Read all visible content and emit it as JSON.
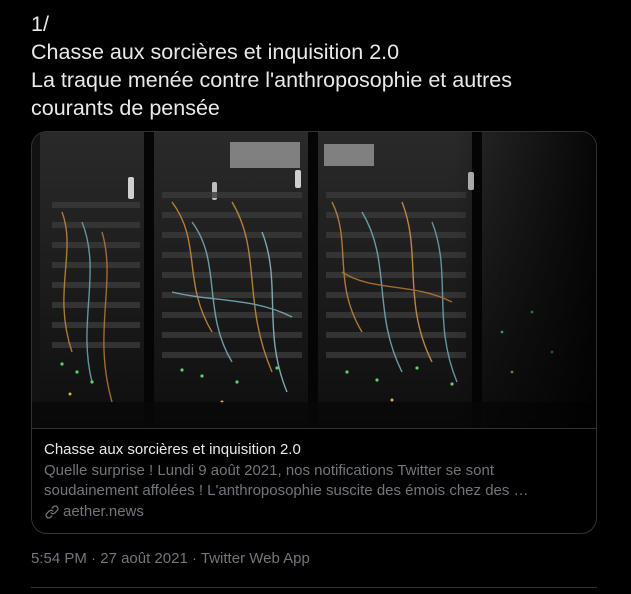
{
  "tweet": {
    "text_lines": [
      "1/",
      "Chasse aux sorcières et inquisition 2.0",
      "La traque menée contre l'anthroposophie et autres",
      "courants de pensée"
    ]
  },
  "card": {
    "title": "Chasse aux sorcières et inquisition 2.0",
    "description_lines": [
      "Quelle surprise ! Lundi 9 août 2021, nos notifications Twitter se sont",
      "soudainement affolées ! L'anthroposophie suscite des émois chez des …"
    ],
    "domain": "aether.news",
    "domain_icon": "link-icon"
  },
  "meta": {
    "time": "5:54 PM",
    "separator": "·",
    "date": "27 août 2021",
    "source": "Twitter Web App"
  },
  "colors": {
    "background": "#000000",
    "text": "#e7e9ea",
    "secondary": "#71767b",
    "border": "#2f3336"
  }
}
